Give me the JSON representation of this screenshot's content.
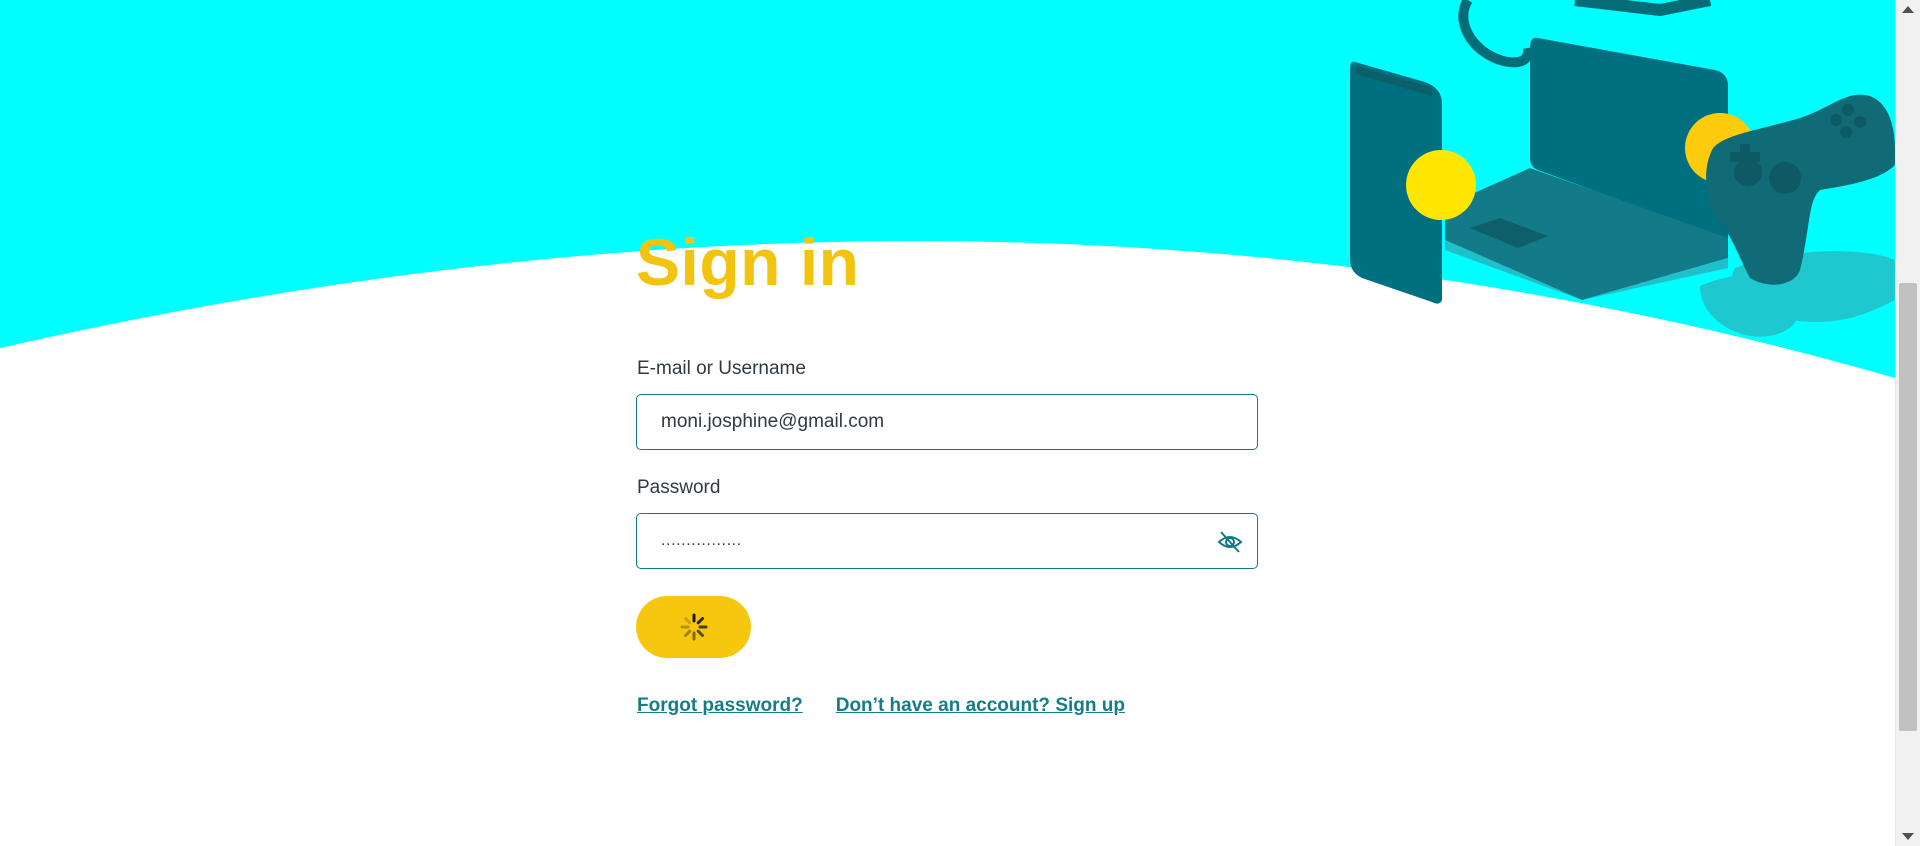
{
  "colors": {
    "hero_bg": "#00ffff",
    "title": "#f2c40f",
    "field_border": "#117a83",
    "button": "#f7c70f",
    "link": "#167d86",
    "device_dark": "#006a75"
  },
  "signin": {
    "title": "Sign in",
    "email": {
      "label": "E-mail or Username",
      "value": "moni.josphine@gmail.com"
    },
    "password": {
      "label": "Password",
      "value": "................",
      "toggle_icon": "eye-slash-icon"
    },
    "submit": {
      "state": "loading",
      "icon": "spinner-icon"
    },
    "links": {
      "forgot": "Forgot password?",
      "signup": "Don’t have an account? Sign up"
    }
  },
  "illustration": {
    "items": [
      "phone",
      "laptop",
      "gamepad"
    ]
  }
}
